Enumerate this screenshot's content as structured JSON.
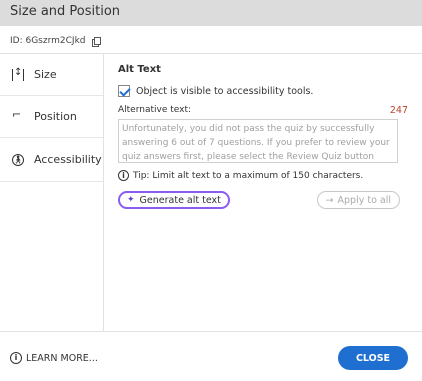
{
  "window": {
    "title": "Size and Position"
  },
  "id_bar": {
    "label": "ID: 6Gszrm2CJkd"
  },
  "sidebar": {
    "items": [
      {
        "label": "Size",
        "icon": "resize-vertical-icon"
      },
      {
        "label": "Position",
        "icon": "position-icon"
      },
      {
        "label": "Accessibility",
        "icon": "accessibility-icon"
      }
    ]
  },
  "alt_text": {
    "section_title": "Alt Text",
    "checkbox_label": "Object is visible to accessibility tools.",
    "field_label": "Alternative text:",
    "char_count": "247",
    "value": "Unfortunately, you did not pass the quiz by successfully answering 6 out of 7 questions. If you prefer to review your quiz answers first, please select the Review Quiz button below, otherwise select",
    "tip": "Tip: Limit alt text to a maximum of 150 characters.",
    "generate_label": "Generate alt text",
    "apply_label": "Apply to all"
  },
  "footer": {
    "learn_more": "LEARN MORE...",
    "close": "CLOSE"
  },
  "colors": {
    "accent": "#1f6fd1",
    "count": "#b8452b",
    "generate_border": "#8a5cf0"
  }
}
